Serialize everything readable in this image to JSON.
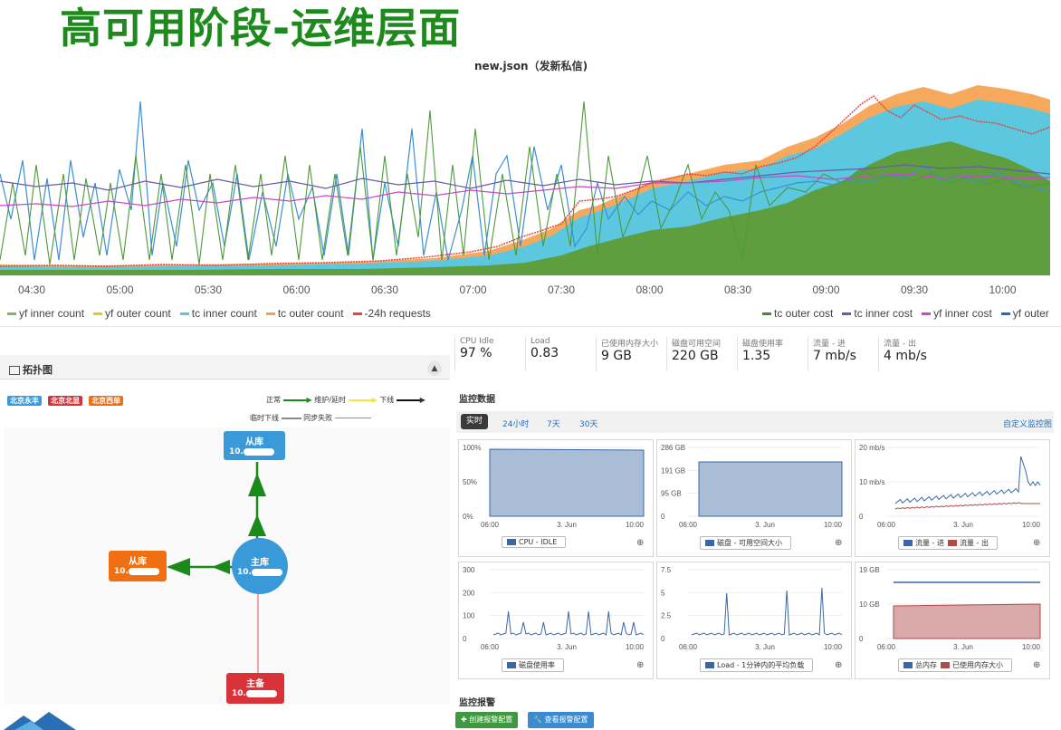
{
  "slide": {
    "title": "高可用阶段-运维层面"
  },
  "main_chart": {
    "title": "new.json（发新私信)",
    "x_ticks": [
      "04:30",
      "05:00",
      "05:30",
      "06:00",
      "06:30",
      "07:00",
      "07:30",
      "08:00",
      "08:30",
      "09:00",
      "09:30",
      "10:00"
    ],
    "legend_left": [
      {
        "name": "yf inner count",
        "color": "#7cb95a"
      },
      {
        "name": "yf outer count",
        "color": "#f0c419"
      },
      {
        "name": "tc inner count",
        "color": "#5cc8e0"
      },
      {
        "name": "tc outer count",
        "color": "#f5a04a"
      },
      {
        "name": "-24h requests",
        "color": "#e8453c"
      }
    ],
    "legend_right": [
      {
        "name": "tc outer cost",
        "color": "#3f8f2f"
      },
      {
        "name": "tc inner cost",
        "color": "#6a5aa8"
      },
      {
        "name": "yf inner cost",
        "color": "#c848c8"
      },
      {
        "name": "yf outer",
        "color": "#1f6fc0"
      }
    ]
  },
  "topology": {
    "title": "拓扑图",
    "collapse_icon": "chevron-up-icon",
    "tags": [
      {
        "label": "北京永丰",
        "color": "#3a9ad9"
      },
      {
        "label": "北京北显",
        "color": "#d9333a"
      },
      {
        "label": "北京西单",
        "color": "#f06f12"
      }
    ],
    "legend_row1": [
      {
        "label": "正常",
        "color": "#1b8a1b"
      },
      {
        "label": "维护/延时",
        "color": "#f4e542"
      },
      {
        "label": "下线",
        "color": "#111111"
      }
    ],
    "legend_row2": [
      {
        "label": "临时下线",
        "color": "#888888"
      },
      {
        "label": "同步失败",
        "color": "#e86a6a"
      }
    ],
    "nodes": {
      "slave_top": {
        "label": "从库",
        "ip": "10.",
        "color": "#3a9ad9"
      },
      "slave_left": {
        "label": "从库",
        "ip": "10.",
        "color": "#f06f12"
      },
      "master": {
        "label": "主库",
        "ip": "10.",
        "color": "#3a9ad9"
      },
      "standby": {
        "label": "主备",
        "ip": "10.",
        "color": "#d9333a"
      }
    }
  },
  "stats": [
    {
      "label": "CPU Idle",
      "value": "97 %"
    },
    {
      "label": "Load",
      "value": "0.83"
    },
    {
      "label": "已使用内存大小",
      "value": "9 GB"
    },
    {
      "label": "磁盘可用空间",
      "value": "220 GB"
    },
    {
      "label": "磁盘使用率",
      "value": "1.35"
    },
    {
      "label": "流量 - 进",
      "value": "7 mb/s"
    },
    {
      "label": "流量 - 出",
      "value": "4 mb/s"
    }
  ],
  "monitor": {
    "title": "监控数据",
    "tabs": [
      "实时",
      "24小时",
      "7天",
      "30天"
    ],
    "custom_link": "自定义监控图"
  },
  "panels": [
    {
      "y_ticks": [
        "100%",
        "50%",
        "0%"
      ],
      "x_ticks": [
        "06:00",
        "3. Jun",
        "10:00"
      ],
      "legend": [
        {
          "name": "CPU - IDLE",
          "color": "#3b67a6"
        }
      ]
    },
    {
      "y_ticks": [
        "286 GB",
        "191 GB",
        "95 GB",
        "0"
      ],
      "x_ticks": [
        "06:00",
        "3. Jun",
        "10:00"
      ],
      "legend": [
        {
          "name": "磁盘 - 可用空间大小",
          "color": "#3b67a6"
        }
      ]
    },
    {
      "y_ticks": [
        "20 mb/s",
        "10 mb/s",
        "0"
      ],
      "x_ticks": [
        "06:00",
        "3. Jun",
        "10:00"
      ],
      "legend": [
        {
          "name": "流量 - 进",
          "color": "#3b67a6"
        },
        {
          "name": "流量 - 出",
          "color": "#b34a4a"
        }
      ]
    },
    {
      "y_ticks": [
        "300",
        "200",
        "100",
        "0"
      ],
      "x_ticks": [
        "06:00",
        "3. Jun",
        "10:00"
      ],
      "legend": [
        {
          "name": "磁盘使用率",
          "color": "#3b67a6"
        }
      ]
    },
    {
      "y_ticks": [
        "7.5",
        "5",
        "2.5",
        "0"
      ],
      "x_ticks": [
        "06:00",
        "3. Jun",
        "10:00"
      ],
      "legend": [
        {
          "name": "Load - 1分钟内的平均负载",
          "color": "#3b67a6"
        }
      ]
    },
    {
      "y_ticks": [
        "19 GB",
        "10 GB",
        "0"
      ],
      "x_ticks": [
        "06:00",
        "3. Jun",
        "10:00"
      ],
      "legend": [
        {
          "name": "总内存",
          "color": "#3b67a6"
        },
        {
          "name": "已使用内存大小",
          "color": "#b34a4a"
        }
      ]
    }
  ],
  "alarm": {
    "title": "监控报警",
    "create_label": "创建报警配置",
    "view_label": "查看报警配置"
  }
}
